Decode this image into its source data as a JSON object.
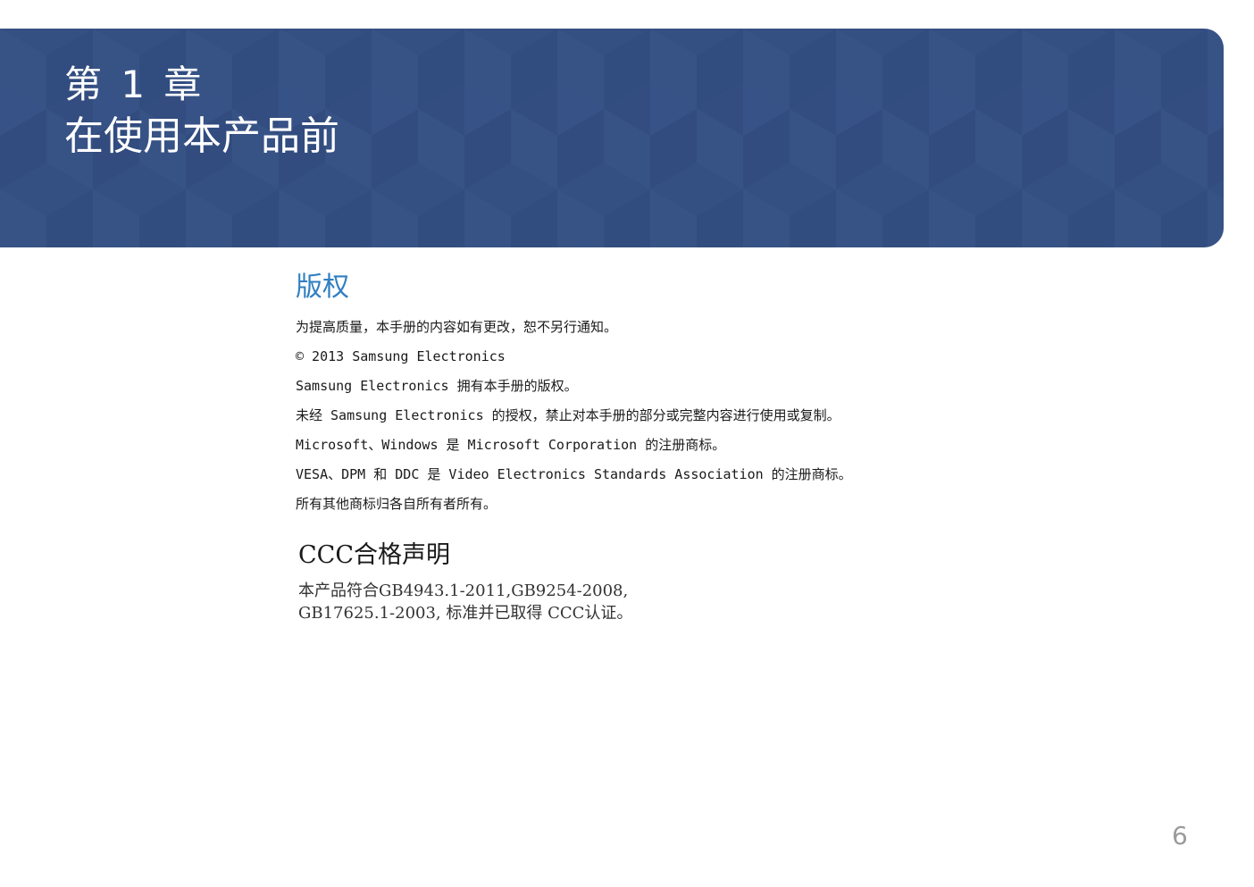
{
  "header": {
    "chapter_number": "第 1 章",
    "chapter_title": "在使用本产品前",
    "background_color": "#344f82"
  },
  "copyright": {
    "heading": "版权",
    "heading_color": "#2f7fc1",
    "paragraphs": [
      "为提高质量，本手册的内容如有更改，恕不另行通知。",
      "© 2013 Samsung Electronics",
      "Samsung Electronics 拥有本手册的版权。",
      "未经 Samsung Electronics 的授权，禁止对本手册的部分或完整内容进行使用或复制。",
      "Microsoft、Windows 是 Microsoft Corporation 的注册商标。",
      "VESA、DPM 和 DDC 是 Video Electronics Standards Association 的注册商标。",
      "所有其他商标归各自所有者所有。"
    ]
  },
  "ccc": {
    "heading": "CCC合格声明",
    "lines": [
      "本产品符合GB4943.1-2011,GB9254-2008,",
      "GB17625.1-2003, 标准并已取得 CCC认证。"
    ]
  },
  "footer": {
    "page_number": "6"
  }
}
